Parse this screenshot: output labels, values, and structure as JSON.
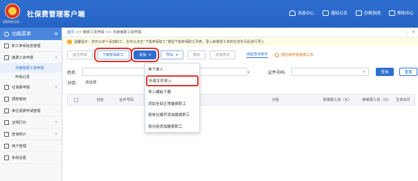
{
  "header": {
    "app_title": "社保费管理客户端",
    "logo_subtitle": "国家税务总局",
    "actions": [
      {
        "label": "消息中心",
        "icon": "message-icon"
      },
      {
        "label": "通知公告",
        "icon": "notice-icon"
      },
      {
        "label": "办税指南",
        "icon": "guide-icon"
      },
      {
        "label": "帮助中心",
        "icon": "help-icon"
      }
    ]
  },
  "sidebar": {
    "title": "功能菜单",
    "items": [
      {
        "label": "职工参保信息管理"
      },
      {
        "label": "缴费工资申报",
        "expanded": true
      },
      {
        "label": "社保费申报"
      },
      {
        "label": "费款缴纳"
      },
      {
        "label": "单位退费申请管理"
      },
      {
        "label": "证明打印"
      },
      {
        "label": "查询统计"
      },
      {
        "label": "用户管理"
      },
      {
        "label": "系统设置"
      }
    ],
    "subitems": [
      {
        "label": "月度缴费工资申报",
        "active": true
      },
      {
        "label": "申报记录",
        "active": false
      }
    ]
  },
  "breadcrumb": {
    "home": "首页",
    "path": ">> 缴费工资申报 >> 月度缴费工资申报"
  },
  "tip": "温馨提示：您可以单个添加职工，也可以点击“下载参保职工”按钮下载参保职工列表，录入新缴费工资和生效年月后进行导入",
  "toolbar": {
    "buttons": [
      "提交申报",
      "下载参保职工",
      "添加",
      "导出",
      "删除",
      "批量修改"
    ],
    "add_arrow": "▾",
    "export_arrow": "▾",
    "tab_link": "收起查询条件",
    "radio_link": "按险种申报缴费工资"
  },
  "search": {
    "name_label": "姓名:",
    "name_value": "",
    "select_arrow": "∨",
    "id_label": "证件号码:",
    "id_value": "",
    "group_label": "分组:",
    "group_placeholder": "请选择",
    "search_button": "查询",
    "reset_button": "重置"
  },
  "table": {
    "columns": [
      "",
      "姓名",
      "证件号码",
      "",
      "分组",
      "原缴费工资（元）",
      "新缴费工资（元）",
      "生效年月"
    ]
  },
  "dropdown": {
    "items": [
      "单个录入",
      "外部文件导入",
      "导入模板下载",
      "添加全部正常缴费职工",
      "按单位编号添加缴费职工",
      "按分组添加缴费职工"
    ]
  }
}
